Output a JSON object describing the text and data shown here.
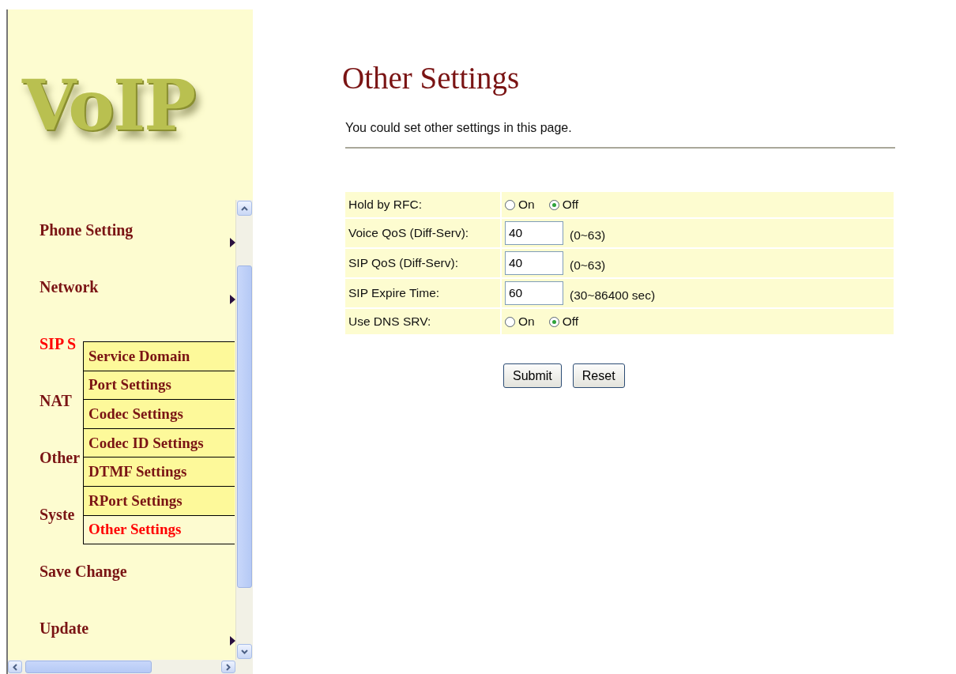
{
  "logo": {
    "text": "VoIP"
  },
  "menu": [
    {
      "label": "Phone Setting",
      "selected": false,
      "arrow": true
    },
    {
      "label": "Network",
      "selected": false,
      "arrow": true
    },
    {
      "label": "SIP S",
      "selected": true,
      "arrow": false
    },
    {
      "label": "NAT",
      "selected": false,
      "arrow": false
    },
    {
      "label": "Other",
      "selected": false,
      "arrow": false
    },
    {
      "label": "Syste",
      "selected": false,
      "arrow": false
    },
    {
      "label": "Save Change",
      "selected": false,
      "arrow": false
    },
    {
      "label": "Update",
      "selected": false,
      "arrow": true
    }
  ],
  "submenu": [
    {
      "label": "Service Domain",
      "selected": false
    },
    {
      "label": "Port Settings",
      "selected": false
    },
    {
      "label": "Codec Settings",
      "selected": false
    },
    {
      "label": "Codec ID Settings",
      "selected": false
    },
    {
      "label": "DTMF Settings",
      "selected": false
    },
    {
      "label": "RPort Settings",
      "selected": false
    },
    {
      "label": "Other Settings",
      "selected": true
    }
  ],
  "page": {
    "title": "Other Settings",
    "description": "You could set other settings in this page."
  },
  "settings": [
    {
      "kind": "radio",
      "label": "Hold by RFC:",
      "options": [
        {
          "label": "On",
          "selected": false
        },
        {
          "label": "Off",
          "selected": true
        }
      ]
    },
    {
      "kind": "input",
      "label": "Voice QoS (Diff-Serv):",
      "value": "40",
      "hint": "(0~63)"
    },
    {
      "kind": "input",
      "label": "SIP QoS (Diff-Serv):",
      "value": "40",
      "hint": "(0~63)"
    },
    {
      "kind": "input",
      "label": "SIP Expire Time:",
      "value": "60",
      "hint": "(30~86400 sec)"
    },
    {
      "kind": "radio",
      "label": "Use DNS SRV:",
      "options": [
        {
          "label": "On",
          "selected": false
        },
        {
          "label": "Off",
          "selected": true
        }
      ]
    }
  ],
  "buttons": [
    "Submit",
    "Reset"
  ]
}
